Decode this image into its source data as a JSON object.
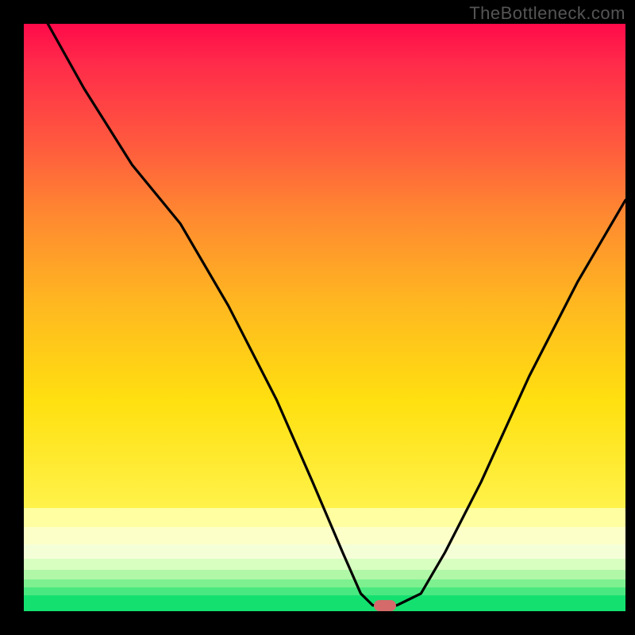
{
  "watermark": "TheBottleneck.com",
  "colors": {
    "frame": "#000000",
    "gradient_top": "#ff0a4a",
    "gradient_mid": "#ffe010",
    "gradient_bottom": "#14e070",
    "curve": "#000000",
    "marker": "#d46a6a"
  },
  "chart_data": {
    "type": "line",
    "title": "",
    "xlabel": "",
    "ylabel": "",
    "xlim": [
      0,
      100
    ],
    "ylim": [
      0,
      100
    ],
    "note": "No axis tick labels are visible; x and y normalized 0–100. y=0 is the bottom green edge, y=100 is the top of the colored region.",
    "series": [
      {
        "name": "bottleneck-curve",
        "x": [
          4,
          10,
          18,
          26,
          34,
          42,
          48,
          53,
          56,
          58,
          62,
          66,
          70,
          76,
          84,
          92,
          100
        ],
        "y": [
          100,
          89,
          76,
          66,
          52,
          36,
          22,
          10,
          3,
          1,
          1,
          3,
          10,
          22,
          40,
          56,
          70
        ]
      }
    ],
    "marker": {
      "x": 60,
      "y": 1,
      "shape": "rounded-rect"
    },
    "background": {
      "orientation": "vertical",
      "stops": [
        {
          "pos": 0.0,
          "color": "#ff0a4a"
        },
        {
          "pos": 0.4,
          "color": "#ff8a30"
        },
        {
          "pos": 0.78,
          "color": "#ffe010"
        },
        {
          "pos": 0.86,
          "color": "#fdffc8"
        },
        {
          "pos": 0.93,
          "color": "#b0f8a8"
        },
        {
          "pos": 1.0,
          "color": "#14e070"
        }
      ]
    }
  }
}
